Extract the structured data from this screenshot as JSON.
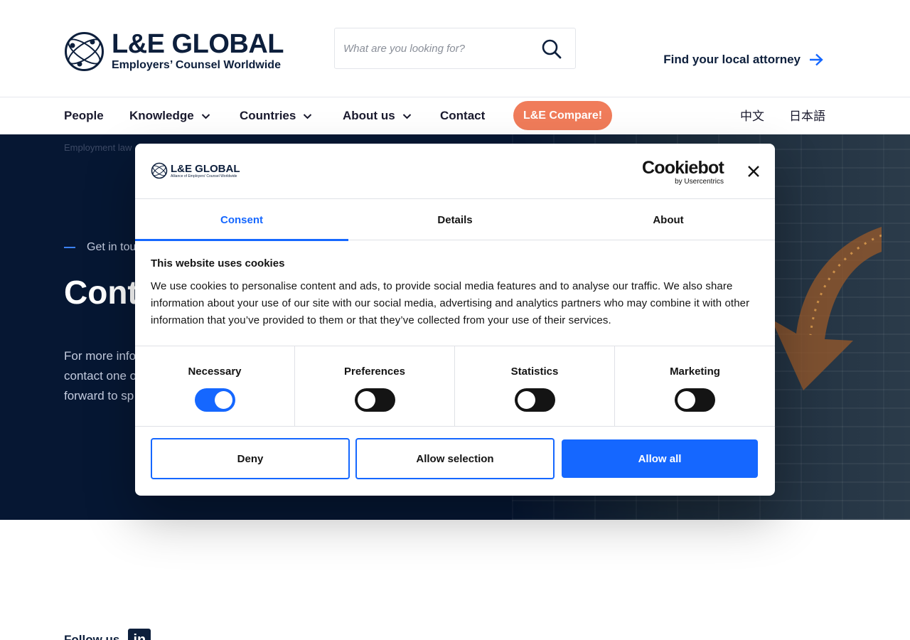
{
  "header": {
    "logo_title": "L&E GLOBAL",
    "logo_subtitle": "Employers’ Counsel Worldwide",
    "search_placeholder": "What are you looking for?",
    "find_attorney": "Find your local attorney"
  },
  "nav": {
    "items": [
      {
        "label": "People"
      },
      {
        "label": "Knowledge"
      },
      {
        "label": "Countries"
      },
      {
        "label": "About us"
      },
      {
        "label": "Contact"
      }
    ],
    "cta": "L&E Compare!",
    "languages": [
      "中文",
      "日本語"
    ]
  },
  "hero": {
    "breadcrumb": "Employment law",
    "eyebrow": "Get in tou",
    "title": "Cont",
    "text_lines": [
      "For more info",
      "contact one o",
      "forward to sp"
    ]
  },
  "footer": {
    "follow_label": "Follow us",
    "linkedin": "in"
  },
  "cookie_dialog": {
    "logo_title": "L&E GLOBAL",
    "logo_subtitle": "Alliance of Employers' Counsel Worldwide",
    "brand_name": "Cookiebot",
    "brand_by": "by Usercentrics",
    "tabs": [
      {
        "label": "Consent",
        "active": true
      },
      {
        "label": "Details",
        "active": false
      },
      {
        "label": "About",
        "active": false
      }
    ],
    "title": "This website uses cookies",
    "text": "We use cookies to personalise content and ads, to provide social media features and to analyse our traffic. We also share information about your use of our site with our social media, advertising and analytics partners who may combine it with other information that you’ve provided to them or that they’ve collected from your use of their services.",
    "toggles": [
      {
        "label": "Necessary",
        "on": true
      },
      {
        "label": "Preferences",
        "on": false
      },
      {
        "label": "Statistics",
        "on": false
      },
      {
        "label": "Marketing",
        "on": false
      }
    ],
    "buttons": {
      "deny": "Deny",
      "allow_selection": "Allow selection",
      "allow_all": "Allow all"
    }
  },
  "colors": {
    "navy": "#0d1f3c",
    "accent": "#1567ff",
    "cta": "#f07c5a",
    "hero_bg": "#061733"
  }
}
